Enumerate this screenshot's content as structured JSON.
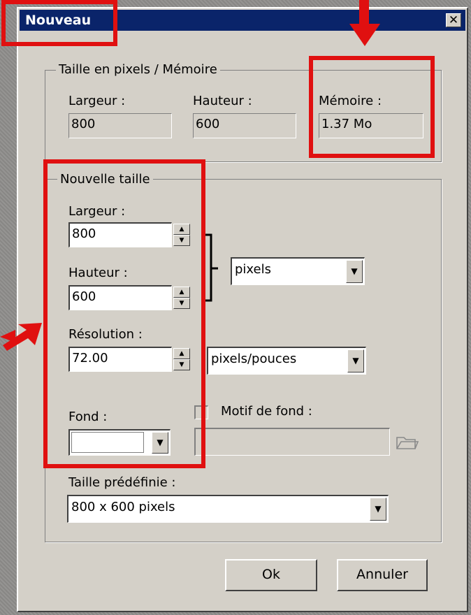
{
  "window": {
    "title": "Nouveau",
    "close_glyph": "✕"
  },
  "pixel_memory": {
    "group_label": "Taille en pixels / Mémoire",
    "width_label": "Largeur :",
    "width_value": "800",
    "height_label": "Hauteur :",
    "height_value": "600",
    "memory_label": "Mémoire :",
    "memory_value": "1.37 Mo"
  },
  "new_size": {
    "group_label": "Nouvelle taille",
    "width_label": "Largeur :",
    "width_value": "800",
    "height_label": "Hauteur :",
    "height_value": "600",
    "unit_value": "pixels",
    "resolution_label": "Résolution :",
    "resolution_value": "72.00",
    "resolution_unit_value": "pixels/pouces",
    "background_label": "Fond :",
    "background_color": "#ffffff",
    "pattern_label": "Motif de fond :",
    "pattern_checked": false,
    "preset_label": "Taille prédéfinie :",
    "preset_value": "800 x 600 pixels"
  },
  "buttons": {
    "ok": "Ok",
    "cancel": "Annuler"
  },
  "icons": {
    "spin_up": "▲",
    "spin_down": "▼",
    "dropdown": "▼",
    "folder": "folder-open-icon"
  },
  "annotation": {
    "highlight_color": "#e01010"
  }
}
